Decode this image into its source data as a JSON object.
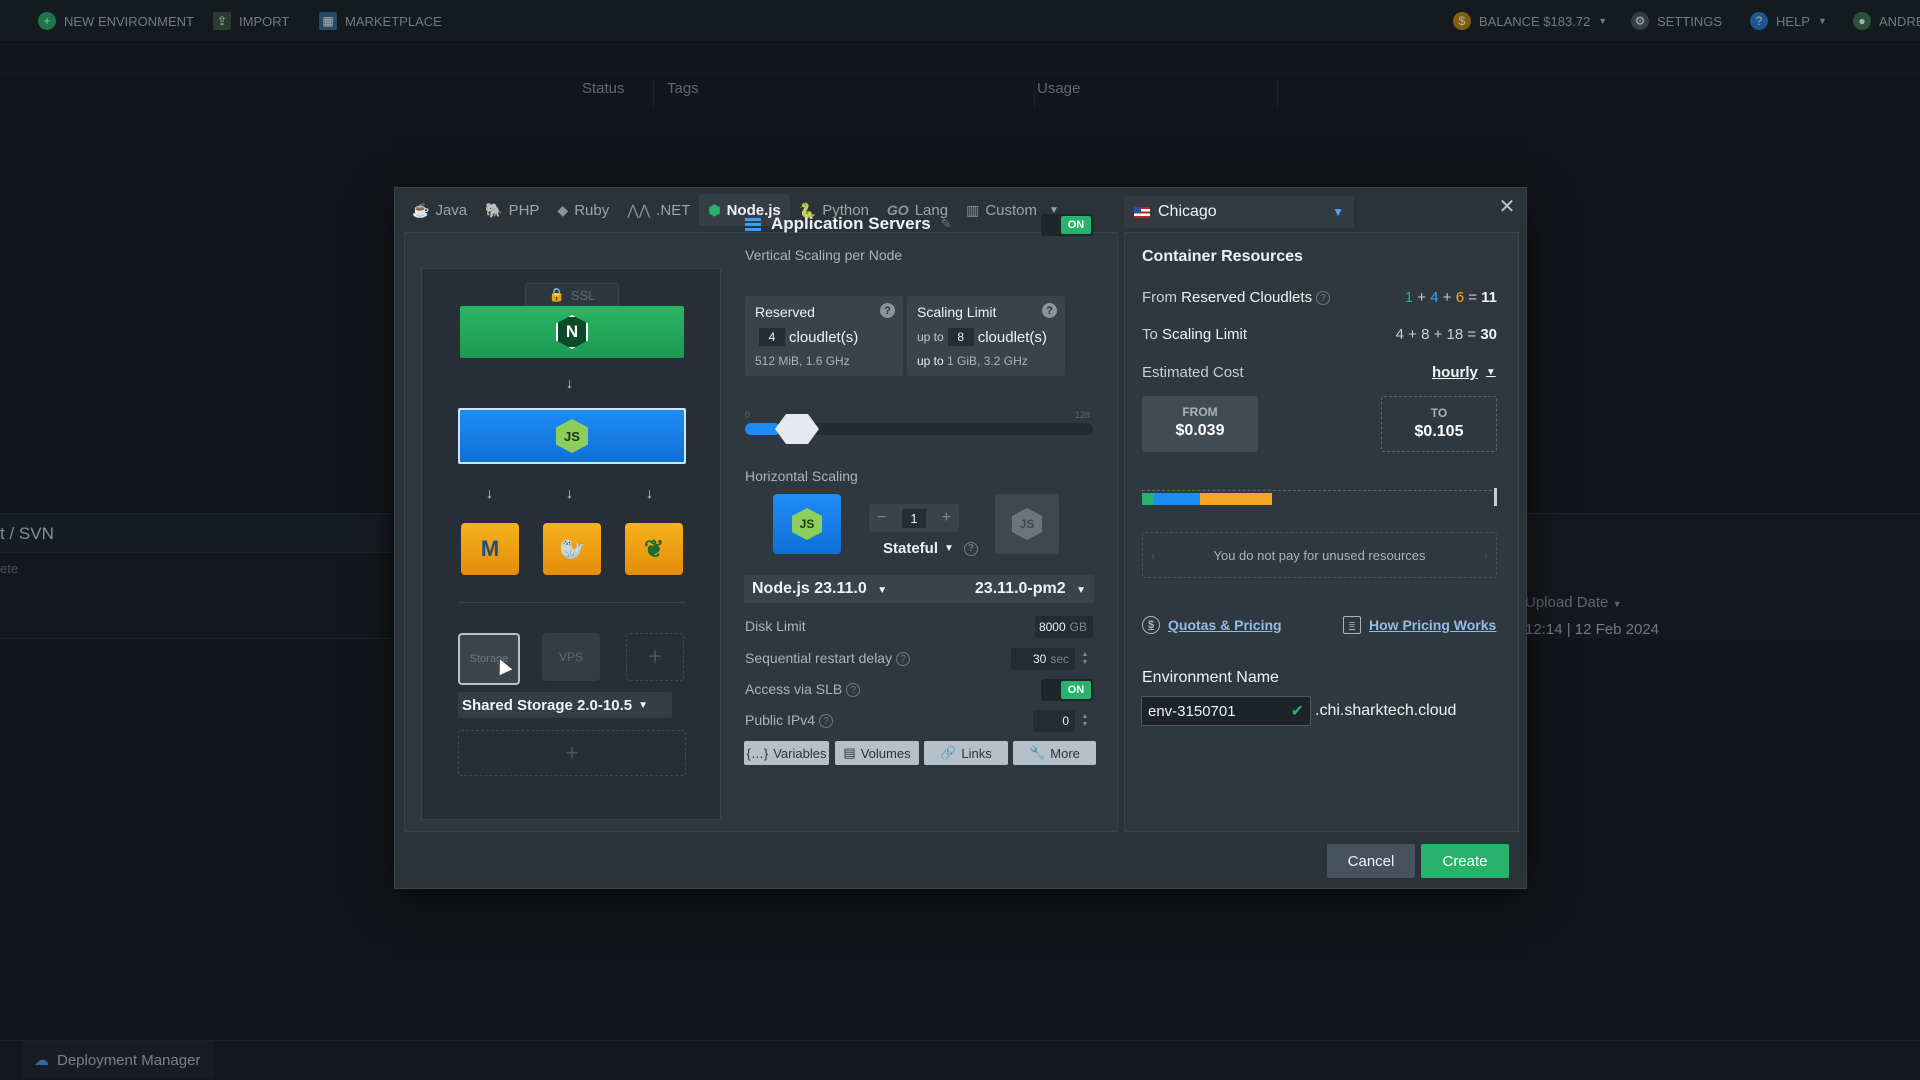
{
  "topbar": {
    "new_environment": "NEW ENVIRONMENT",
    "import": "IMPORT",
    "marketplace": "MARKETPLACE",
    "balance": "BALANCE $183.72",
    "settings": "SETTINGS",
    "help": "HELP",
    "user": "ANDRE"
  },
  "table_headers": {
    "status": "Status",
    "tags": "Tags",
    "usage": "Usage"
  },
  "background": {
    "git_svn_tab": "t / SVN",
    "row_text": "ete",
    "upload_date_header": "Upload Date",
    "upload_date_value": "12:14 | 12 Feb 2024"
  },
  "bottom": {
    "deployment_manager": "Deployment Manager"
  },
  "dialog": {
    "lang_tabs": [
      {
        "label": "Java",
        "icon": "java-icon"
      },
      {
        "label": "PHP",
        "icon": "php-icon"
      },
      {
        "label": "Ruby",
        "icon": "ruby-icon"
      },
      {
        "label": ".NET",
        "icon": "dotnet-icon"
      },
      {
        "label": "Node.js",
        "icon": "nodejs-icon",
        "active": true
      },
      {
        "label": "Python",
        "icon": "python-icon"
      },
      {
        "label": "Lang",
        "icon": "go-icon"
      },
      {
        "label": "Custom",
        "icon": "custom-icon"
      }
    ],
    "go_logo": "GO",
    "region": "Chicago",
    "topology": {
      "ssl": "SSL",
      "nginx_icon": "N",
      "nodejs_icon": "JS",
      "storage_label": "Storage",
      "vps_label": "VPS",
      "storage_select": "Shared Storage 2.0-10.5"
    },
    "app_servers": {
      "title": "Application Servers",
      "toggle": "ON",
      "vertical_label": "Vertical Scaling per Node",
      "reserved": {
        "title": "Reserved",
        "value": "4",
        "unit": "cloudlet(s)",
        "specs": "512 MiB, 1.6 GHz"
      },
      "scaling_limit": {
        "title": "Scaling Limit",
        "prefix": "up to",
        "value": "8",
        "unit": "cloudlet(s)",
        "specs_prefix": "up to",
        "specs": "1 GiB, 3.2 GHz"
      },
      "slider_min": "0",
      "slider_max": "128",
      "horizontal_label": "Horizontal Scaling",
      "node_count": "1",
      "stateful": "Stateful",
      "engine": "Node.js 23.11.0",
      "engine_version": "23.11.0-pm2",
      "disk_limit": {
        "label": "Disk Limit",
        "value": "8000",
        "unit": "GB"
      },
      "restart_delay": {
        "label": "Sequential restart delay",
        "value": "30",
        "unit": "sec"
      },
      "slb": {
        "label": "Access via SLB",
        "value": "ON"
      },
      "ipv4": {
        "label": "Public IPv4",
        "value": "0"
      },
      "buttons": {
        "variables": "Variables",
        "volumes": "Volumes",
        "links": "Links",
        "more": "More"
      }
    },
    "resources": {
      "title": "Container Resources",
      "reserved": {
        "prefix": "From",
        "label": "Reserved Cloudlets",
        "a": "1",
        "b": "4",
        "c": "6",
        "total": "11"
      },
      "limit": {
        "prefix": "To",
        "label": "Scaling Limit",
        "expr": "4 + 8 + 18 =",
        "total": "30"
      },
      "estimated_cost": "Estimated Cost",
      "period": "hourly",
      "from": {
        "label": "FROM",
        "value": "$0.039"
      },
      "to": {
        "label": "TO",
        "value": "$0.105"
      },
      "unused_note": "You do not pay for unused resources",
      "quotas_link": "Quotas & Pricing",
      "pricing_link": "How Pricing Works",
      "env_name_label": "Environment Name",
      "env_name_value": "env-3150701",
      "domain_suffix": ".chi.sharktech.cloud"
    },
    "cancel": "Cancel",
    "create": "Create"
  }
}
